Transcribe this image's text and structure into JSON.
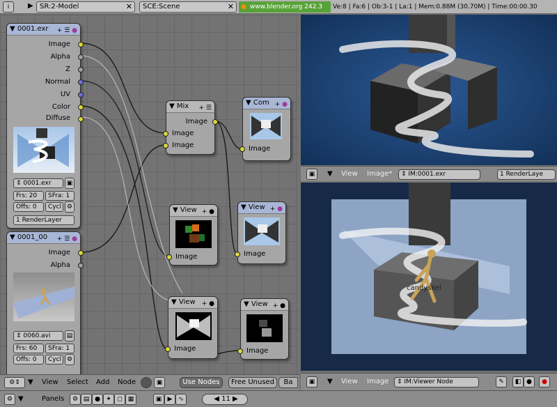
{
  "topbar": {
    "screen": "SR:2-Model",
    "scene": "SCE:Scene",
    "url": "www.blender.org 242.3",
    "stats": "Ve:8 | Fa:6 | Ob:3-1 | La:1  | Mem:0.88M (30.70M)  | Time:00:00.30"
  },
  "nodes": {
    "renderlayer": {
      "title": "0001.exr",
      "outputs": [
        "Image",
        "Alpha",
        "Z",
        "Normal",
        "UV",
        "Color",
        "Diffuse"
      ],
      "image_name": "0001.exr",
      "frs": "Frs: 20",
      "sfra": "SFra: 1",
      "offs": "Offs: 0",
      "cycl": "Cycl",
      "layer": "1 RenderLayer"
    },
    "movie": {
      "title": "0001_00",
      "outputs": [
        "Image",
        "Alpha"
      ],
      "image_name": "0060.avi",
      "frs": "Frs: 60",
      "sfra": "SFra: 1",
      "offs": "Offs: 0",
      "cycl": "Cycl"
    },
    "mix": {
      "title": "Mix",
      "output": "Image",
      "inputs": [
        "Image",
        "Image"
      ]
    },
    "composite": {
      "title": "Com",
      "input": "Image"
    },
    "viewer1": {
      "title": "View",
      "input": "Image"
    },
    "viewer2": {
      "title": "View",
      "input": "Image"
    },
    "viewer3": {
      "title": "View",
      "input": "Image"
    },
    "viewer4": {
      "title": "View",
      "input": "Image"
    }
  },
  "node_header": {
    "menus": [
      "View",
      "Select",
      "Add",
      "Node"
    ],
    "use_nodes": "Use Nodes",
    "free_unused": "Free Unused",
    "backdrop": "Ba"
  },
  "image_top_header": {
    "menus": [
      "View",
      "Image*"
    ],
    "image": "IM:0001.exr",
    "layer": "1 RenderLaye"
  },
  "image_bottom_header": {
    "menus": [
      "View",
      "Image"
    ],
    "image": "IM:Viewer Node"
  },
  "viewport_label": "candyskel",
  "panels_bar": {
    "label": "Panels",
    "frame": "11"
  },
  "colors": {
    "accent_green": "#59a23a",
    "socket_yellow": "#d8d83a",
    "socket_blue": "#6f6fd8"
  }
}
